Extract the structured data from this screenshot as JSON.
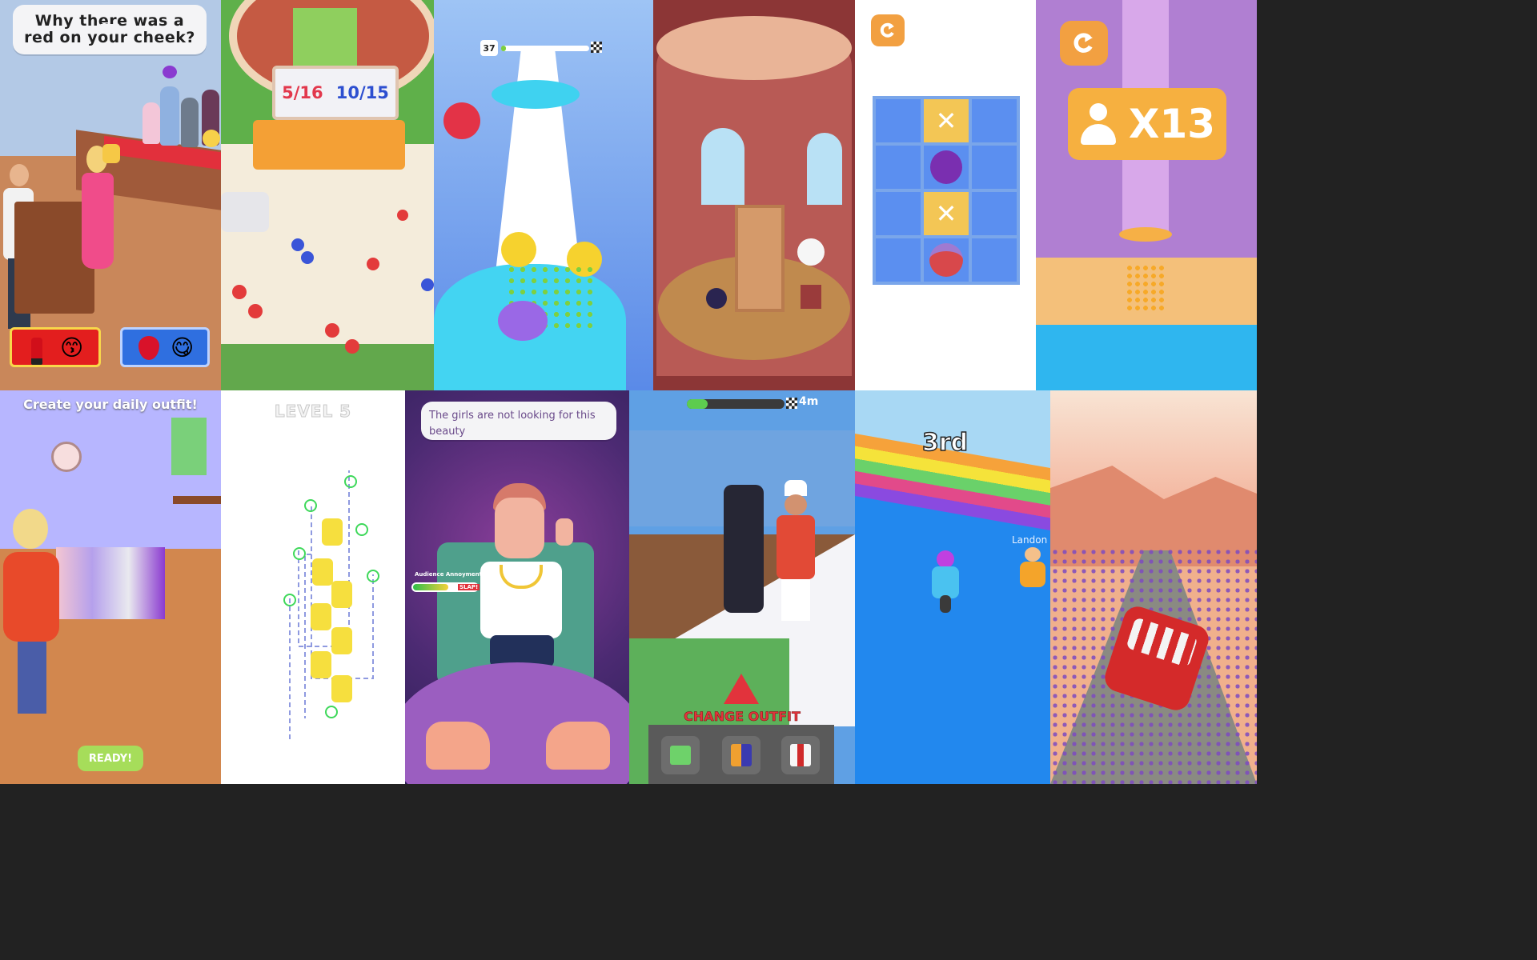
{
  "tile1": {
    "question": "Why there was a red on your cheek?",
    "option_left_emoji": "😙",
    "option_right_emoji": "😋"
  },
  "tile2": {
    "score_left": "5/16",
    "score_right": "10/15"
  },
  "tile3": {
    "level_number": "37"
  },
  "tile5": {
    "restart_icon": "restart-icon"
  },
  "tile6": {
    "multiplier": "X13"
  },
  "tile7": {
    "title": "Create your daily outfit!",
    "ready_label": "READY!"
  },
  "tile8": {
    "level_label": "LEVEL 5"
  },
  "tile9": {
    "speech": "The girls are not looking for this beauty",
    "meter_label": "Audience Annoyment",
    "slap_label": "SLAP!"
  },
  "tile10": {
    "distance": "4m",
    "warning_label": "CHANGE OUTFIT"
  },
  "tile11": {
    "position": "3rd",
    "player_name": "Landon"
  },
  "colors": {
    "accent_orange": "#f2a041",
    "red_button": "#e31e1e",
    "blue_button": "#2f6fe0",
    "ready_green": "#a6dd5a"
  }
}
